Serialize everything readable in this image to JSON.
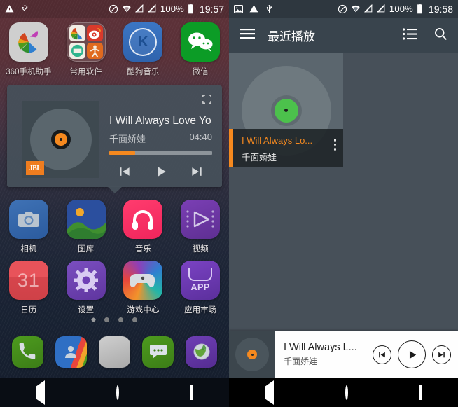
{
  "left_screen": {
    "status_bar": {
      "icons_left": [
        "warning-triangle-icon",
        "usb-icon"
      ],
      "icons_right": [
        "do-not-disturb-icon",
        "wifi-icon",
        "signal-off-icon",
        "signal-off-icon"
      ],
      "battery_percent": "100%",
      "time": "19:57"
    },
    "app_rows": [
      [
        {
          "label": "360手机助手",
          "icon": "app-360-assistant-icon"
        },
        {
          "label": "常用软件",
          "icon": "folder-icon"
        },
        {
          "label": "酷狗音乐",
          "icon": "kugou-music-icon",
          "glyph": "K"
        },
        {
          "label": "微信",
          "icon": "wechat-icon"
        }
      ],
      [
        {
          "label": "相机",
          "icon": "camera-icon"
        },
        {
          "label": "图库",
          "icon": "gallery-icon"
        },
        {
          "label": "音乐",
          "icon": "music-headphones-icon"
        },
        {
          "label": "视频",
          "icon": "video-play-icon"
        }
      ],
      [
        {
          "label": "日历",
          "icon": "calendar-icon",
          "glyph": "31"
        },
        {
          "label": "设置",
          "icon": "settings-gear-icon"
        },
        {
          "label": "游戏中心",
          "icon": "gamepad-icon"
        },
        {
          "label": "应用市场",
          "icon": "app-market-icon",
          "glyph": "APP"
        }
      ]
    ],
    "page_dots": {
      "count": 4,
      "active_index": 0
    },
    "dock": [
      {
        "name": "phone-icon"
      },
      {
        "name": "contacts-icon"
      },
      {
        "name": "app-drawer-icon"
      },
      {
        "name": "messages-icon"
      },
      {
        "name": "browser-icon"
      }
    ],
    "widget": {
      "title": "I Will Always Love Yo...",
      "artist": "千面娇娃",
      "duration": "04:40",
      "progress_percent": 25,
      "brand_badge": "JBL",
      "expand_icon": "expand-fullscreen-icon",
      "controls": [
        "previous-track-icon",
        "play-icon",
        "next-track-icon"
      ],
      "accent_color": "#f5891f"
    },
    "nav_bar": [
      "back-icon",
      "home-icon",
      "recents-icon"
    ]
  },
  "right_screen": {
    "status_bar": {
      "icons_left": [
        "image-icon",
        "warning-triangle-icon",
        "usb-icon"
      ],
      "icons_right": [
        "do-not-disturb-icon",
        "wifi-icon",
        "signal-off-icon",
        "signal-off-icon"
      ],
      "battery_percent": "100%",
      "time": "19:58"
    },
    "app_bar": {
      "menu_icon": "hamburger-menu-icon",
      "title": "最近播放",
      "list_icon": "list-view-icon",
      "search_icon": "search-icon"
    },
    "cards": [
      {
        "title": "I Will Always Lo...",
        "artist": "千面娇娃",
        "overflow_icon": "more-vertical-icon",
        "accent_color": "#f5891f"
      }
    ],
    "player_bar": {
      "title": "I Will Always L...",
      "artist": "千面娇娃",
      "controls": [
        "previous-track-icon",
        "play-icon",
        "next-track-icon"
      ]
    },
    "nav_bar": [
      "back-icon",
      "home-icon",
      "recents-icon"
    ]
  }
}
